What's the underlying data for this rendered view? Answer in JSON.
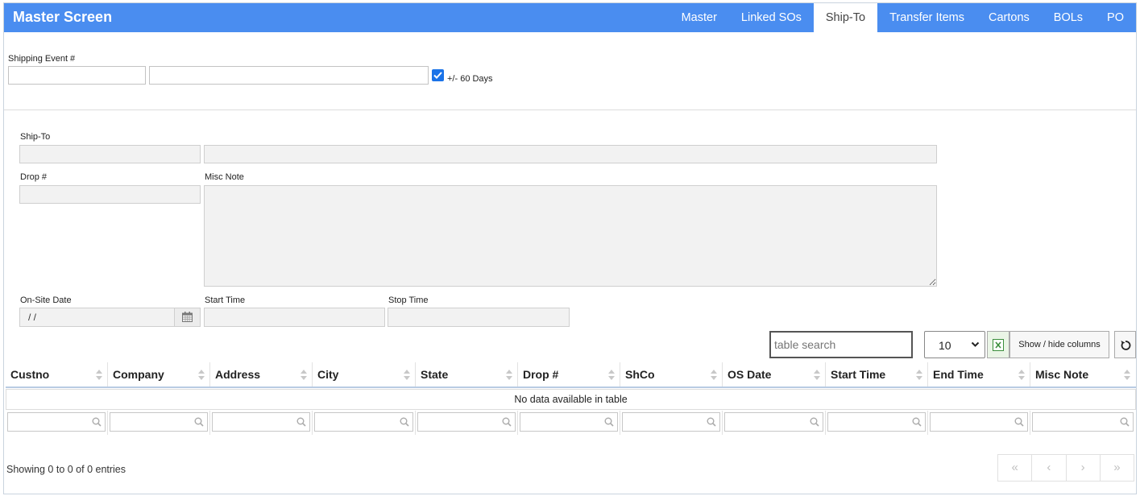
{
  "header": {
    "title": "Master Screen",
    "tabs": [
      "Master",
      "Linked SOs",
      "Ship-To",
      "Transfer Items",
      "Cartons",
      "BOLs",
      "PO"
    ],
    "active_tab": "Ship-To",
    "bar_color": "#4a8df0"
  },
  "filter": {
    "shipping_event_label": "Shipping Event #",
    "shipping_event_value": "",
    "shipping_event_desc": "",
    "days_checkbox_label": "+/- 60 Days",
    "days_checked": true
  },
  "form": {
    "ship_to_label": "Ship-To",
    "drop_label": "Drop #",
    "misc_note_label": "Misc Note",
    "onsite_date_label": "On-Site Date",
    "onsite_date_value": " /  /",
    "start_time_label": "Start Time",
    "stop_time_label": "Stop Time"
  },
  "table_controls": {
    "search_placeholder": "table search",
    "page_length": "10",
    "show_hide_label": "Show / hide columns"
  },
  "table": {
    "columns": [
      "Custno",
      "Company",
      "Address",
      "City",
      "State",
      "Drop #",
      "ShCo",
      "OS Date",
      "Start Time",
      "End Time",
      "Misc Note"
    ],
    "empty_message": "No data available in table",
    "info": "Showing 0 to 0 of 0 entries",
    "pager": [
      "«",
      "‹",
      "›",
      "»"
    ]
  }
}
